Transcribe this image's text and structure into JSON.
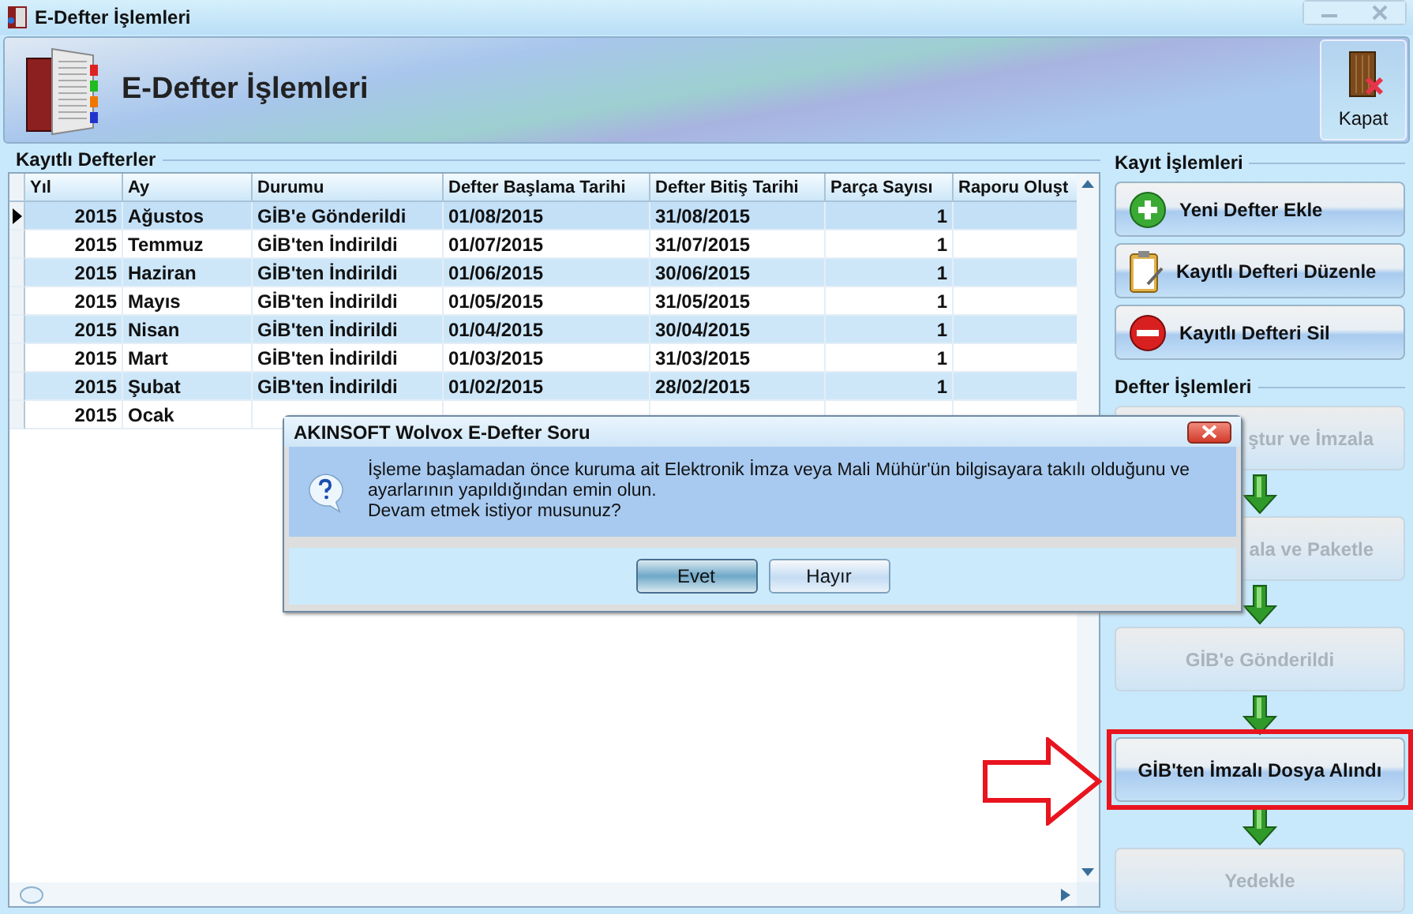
{
  "window": {
    "title": "E-Defter İşlemleri"
  },
  "header": {
    "title": "E-Defter İşlemleri",
    "close_button": "Kapat"
  },
  "records": {
    "title": "Kayıtlı Defterler",
    "columns": [
      "Yıl",
      "Ay",
      "Durumu",
      "Defter Başlama Tarihi",
      "Defter Bitiş Tarihi",
      "Parça Sayısı",
      "Raporu Oluşt"
    ],
    "rows": [
      {
        "cells": [
          "2015",
          "Ağustos",
          "GİB'e Gönderildi",
          "01/08/2015",
          "31/08/2015",
          "1"
        ],
        "selected": true
      },
      {
        "cells": [
          "2015",
          "Temmuz",
          "GİB'ten İndirildi",
          "01/07/2015",
          "31/07/2015",
          "1"
        ],
        "selected": false
      },
      {
        "cells": [
          "2015",
          "Haziran",
          "GİB'ten İndirildi",
          "01/06/2015",
          "30/06/2015",
          "1"
        ],
        "selected": false
      },
      {
        "cells": [
          "2015",
          "Mayıs",
          "GİB'ten İndirildi",
          "01/05/2015",
          "31/05/2015",
          "1"
        ],
        "selected": false
      },
      {
        "cells": [
          "2015",
          "Nisan",
          "GİB'ten İndirildi",
          "01/04/2015",
          "30/04/2015",
          "1"
        ],
        "selected": false
      },
      {
        "cells": [
          "2015",
          "Mart",
          "GİB'ten İndirildi",
          "01/03/2015",
          "31/03/2015",
          "1"
        ],
        "selected": false
      },
      {
        "cells": [
          "2015",
          "Şubat",
          "GİB'ten İndirildi",
          "01/02/2015",
          "28/02/2015",
          "1"
        ],
        "selected": false
      },
      {
        "cells": [
          "2015",
          "Ocak"
        ],
        "selected": false
      }
    ]
  },
  "record_actions": {
    "title": "Kayıt İşlemleri",
    "buttons": [
      {
        "label": "Yeni Defter Ekle",
        "kind": "add"
      },
      {
        "label": "Kayıtlı Defteri Düzenle",
        "kind": "edit"
      },
      {
        "label": "Kayıtlı Defteri Sil",
        "kind": "delete"
      }
    ]
  },
  "book_steps": {
    "title": "Defter İşlemleri",
    "steps": [
      {
        "label": "ştur ve İmzala",
        "disabled": true,
        "covered": true,
        "highlighted": false
      },
      {
        "label": "ala ve Paketle",
        "disabled": true,
        "covered": true,
        "highlighted": false
      },
      {
        "label": "GİB'e Gönderildi",
        "disabled": true,
        "covered": false,
        "highlighted": false
      },
      {
        "label": "GİB'ten İmzalı Dosya Alındı",
        "disabled": false,
        "covered": false,
        "highlighted": true
      },
      {
        "label": "Yedekle",
        "disabled": true,
        "covered": false,
        "highlighted": false
      }
    ]
  },
  "dialog": {
    "title": "AKINSOFT Wolvox E-Defter Soru",
    "message": [
      "İşleme başlamadan önce kuruma ait Elektronik İmza veya Mali Mühür'ün bilgisayara takılı olduğunu ve ayarlarının yapıldığından emin olun.",
      "Devam etmek istiyor musunuz?"
    ],
    "buttons": [
      {
        "label": "Evet",
        "default": true
      },
      {
        "label": "Hayır",
        "default": false
      }
    ]
  }
}
